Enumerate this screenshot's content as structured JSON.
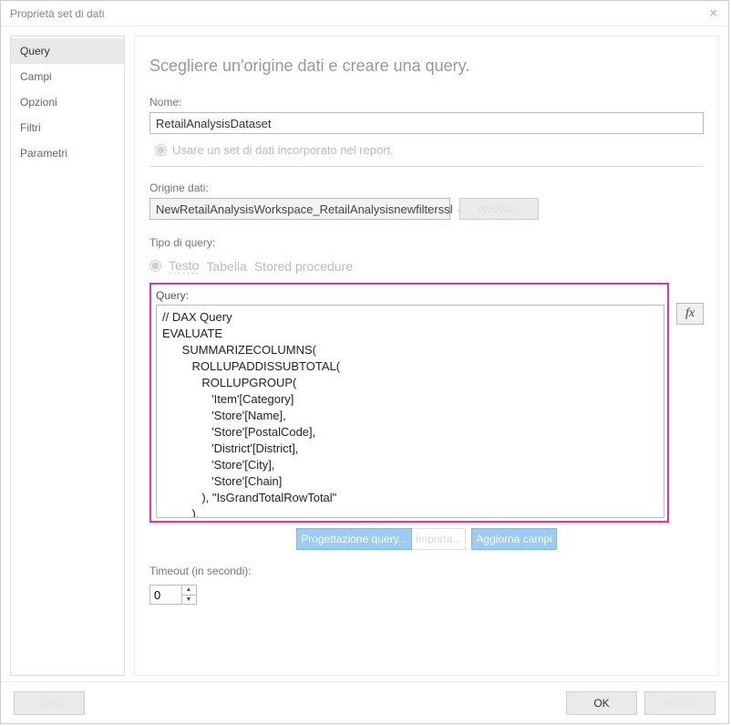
{
  "window": {
    "title": "Proprietà set di dati"
  },
  "sidebar": {
    "items": [
      {
        "label": "Query"
      },
      {
        "label": "Campi"
      },
      {
        "label": "Opzioni"
      },
      {
        "label": "Filtri"
      },
      {
        "label": "Parametri"
      }
    ]
  },
  "main": {
    "heading": "Scegliere un'origine dati e creare una query.",
    "name_label": "Nome:",
    "name_value": "RetailAnalysisDataset",
    "embedded_label": "Usare un set di dati incorporato nel report.",
    "ds_label": "Origine dati:",
    "ds_value": "NewRetailAnalysisWorkspace_RetailAnalysisnewfilterssl",
    "ds_new_btn": "Nuova...",
    "qt_label": "Tipo di query:",
    "qt_options": {
      "text": "Testo",
      "table": "Tabella",
      "sp": "Stored procedure"
    },
    "query_label": "Query:",
    "query_text": "// DAX Query\nEVALUATE\n      SUMMARIZECOLUMNS(\n         ROLLUPADDISSUBTOTAL(\n            ROLLUPGROUP(\n               'Item'[Category]\n               'Store'[Name],\n               'Store'[PostalCode],\n               'District'[District],\n               'Store'[City],\n               'Store'[Chain]\n            ), \"IsGrandTotalRowTotal\"\n         ),\n         \"This_Year_Sales\", 'Sales'[This Year Sales]",
    "fx_label": "fx",
    "design_btn": "Progettazione query...",
    "import_btn": "Importa...",
    "refresh_btn": "Aggiorna campi",
    "timeout_label": "Timeout (in secondi):",
    "timeout_value": "0"
  },
  "footer": {
    "help": "Guida",
    "ok": "OK",
    "cancel": "Annulla"
  }
}
